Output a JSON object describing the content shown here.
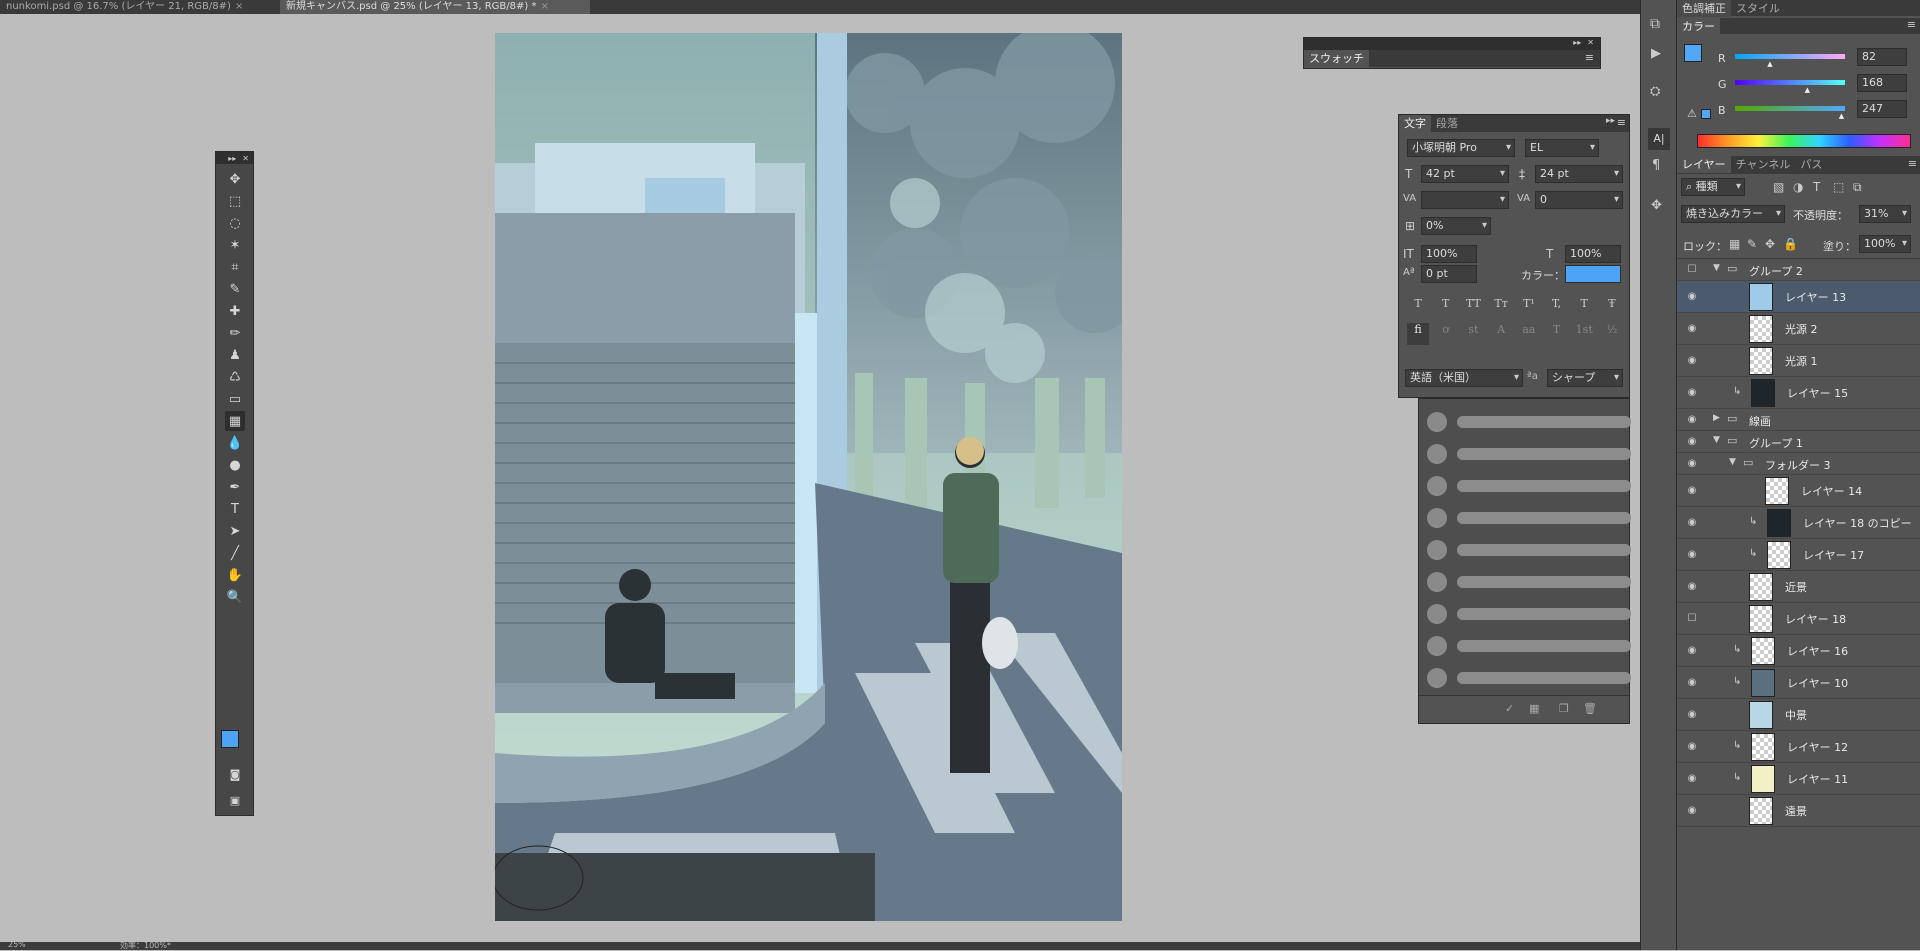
{
  "doc_tabs": [
    {
      "label": "nunkomi.psd @ 16.7% (レイヤー 21, RGB/8#)",
      "close": "×"
    },
    {
      "label": "新規キャンバス.psd @ 25% (レイヤー 13, RGB/8#) *",
      "close": "×"
    }
  ],
  "status": {
    "zoom": "25%",
    "info": "効率：100%*"
  },
  "swatches": {
    "title": "スウォッチ"
  },
  "text_panel": {
    "tabs": [
      "文字",
      "段落"
    ],
    "font_family": "小塚明朝 Pro",
    "font_style": "EL",
    "size": "42 pt",
    "leading": "24 pt",
    "kerning": "",
    "tracking": "0",
    "tsume": "0%",
    "vscale": "100%",
    "hscale": "100%",
    "baseline": "0 pt",
    "color_label": "カラー：",
    "color": "#4da3f5",
    "style_buttons": [
      "T",
      "T",
      "TT",
      "Tт",
      "T¹",
      "T,",
      "T",
      "Ŧ"
    ],
    "ot_buttons": [
      "fi",
      "ơ",
      "st",
      "A",
      "aa",
      "T",
      "1st",
      "½"
    ],
    "language": "英語（米国）",
    "aa_label": "ªa",
    "antialias": "シャープ"
  },
  "color_panel": {
    "top_tabs": [
      "色調補正",
      "スタイル"
    ],
    "tab": "カラー",
    "fg": "#52a8f7",
    "channels": [
      {
        "name": "R",
        "value": "82",
        "pct": 0.32
      },
      {
        "name": "G",
        "value": "168",
        "pct": 0.66
      },
      {
        "name": "B",
        "value": "247",
        "pct": 0.97
      }
    ]
  },
  "layers_panel": {
    "tabs": [
      "レイヤー",
      "チャンネル",
      "パス"
    ],
    "filter": "種類",
    "blend_mode": "焼き込みカラー",
    "opacity_label": "不透明度：",
    "opacity": "31%",
    "lock_label": "ロック：",
    "fill_label": "塗り：",
    "fill": "100%",
    "rows": [
      {
        "type": "group",
        "name": "グループ 2",
        "open": true,
        "indent": 0,
        "visible": false
      },
      {
        "type": "layer",
        "name": "レイヤー 13",
        "indent": 1,
        "selected": true,
        "thumb": "#9fcbe8",
        "clip": false,
        "visible": true
      },
      {
        "type": "layer",
        "name": "光源 2",
        "indent": 1,
        "thumb": "checker",
        "clip": false,
        "visible": true
      },
      {
        "type": "layer",
        "name": "光源 1",
        "indent": 1,
        "thumb": "checker",
        "clip": false,
        "visible": true
      },
      {
        "type": "layer",
        "name": "レイヤー 15",
        "indent": 1,
        "thumb": "#1e262c",
        "clip": true,
        "visible": true
      },
      {
        "type": "group",
        "name": "線画",
        "open": false,
        "indent": 0,
        "visible": true
      },
      {
        "type": "group",
        "name": "グループ 1",
        "open": true,
        "indent": 0,
        "visible": true
      },
      {
        "type": "group",
        "name": "フォルダー 3",
        "open": true,
        "indent": 1,
        "visible": true
      },
      {
        "type": "layer",
        "name": "レイヤー 14",
        "indent": 2,
        "thumb": "checker",
        "clip": false,
        "visible": true
      },
      {
        "type": "layer",
        "name": "レイヤー 18 のコピー",
        "indent": 2,
        "thumb": "#1e262c",
        "clip": true,
        "visible": true
      },
      {
        "type": "layer",
        "name": "レイヤー 17",
        "indent": 2,
        "thumb": "checker",
        "clip": true,
        "visible": true
      },
      {
        "type": "layer",
        "name": "近景",
        "indent": 1,
        "thumb": "checker",
        "clip": false,
        "visible": true
      },
      {
        "type": "layer",
        "name": "レイヤー 18",
        "indent": 1,
        "thumb": "checker",
        "clip": false,
        "visible": false
      },
      {
        "type": "layer",
        "name": "レイヤー 16",
        "indent": 1,
        "thumb": "checker",
        "clip": true,
        "visible": true
      },
      {
        "type": "layer",
        "name": "レイヤー 10",
        "indent": 1,
        "thumb": "#5a7080",
        "clip": true,
        "visible": true
      },
      {
        "type": "layer",
        "name": "中景",
        "indent": 1,
        "thumb": "#b9d6e6",
        "clip": false,
        "visible": true
      },
      {
        "type": "layer",
        "name": "レイヤー 12",
        "indent": 1,
        "thumb": "checker",
        "clip": true,
        "visible": true
      },
      {
        "type": "layer",
        "name": "レイヤー 11",
        "indent": 1,
        "thumb": "#f3f0c6",
        "clip": true,
        "visible": true
      },
      {
        "type": "layer",
        "name": "遠景",
        "indent": 1,
        "thumb": "checker",
        "clip": false,
        "visible": true
      }
    ]
  },
  "tools": [
    "move-icon",
    "marquee-icon",
    "lasso-icon",
    "magic-wand-icon",
    "crop-icon",
    "eyedropper-icon",
    "healing-brush-icon",
    "brush-icon",
    "clone-stamp-icon",
    "history-brush-icon",
    "eraser-icon",
    "gradient-icon",
    "blur-icon",
    "dodge-icon",
    "pen-icon",
    "type-icon",
    "path-select-icon",
    "line-icon",
    "hand-icon",
    "zoom-icon"
  ],
  "tool_glyphs": [
    "✥",
    "⬚",
    "◌",
    "✶",
    "⌗",
    "✎",
    "✚",
    "✏",
    "♟",
    "♺",
    "▭",
    "▦",
    "💧",
    "●",
    "✒",
    "T",
    "➤",
    "╱",
    "✋",
    "🔍"
  ],
  "toolbox_colors": {
    "fg": "#4da3f5",
    "bg": "#ffffff"
  }
}
